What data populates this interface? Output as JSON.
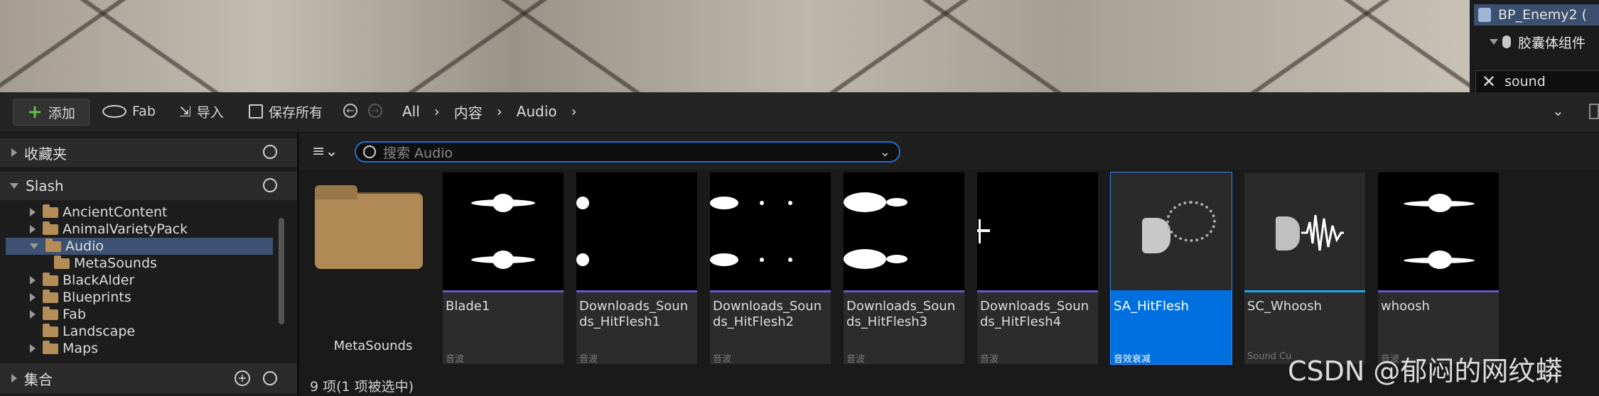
{
  "outliner": {
    "row1": "BP_Enemy2 (",
    "row2": "胶囊体组件",
    "search_value": "sound"
  },
  "toolbar": {
    "add_label": "添加",
    "fab_label": "Fab",
    "import_label": "导入",
    "save_all_label": "保存所有",
    "breadcrumb": [
      "All",
      "内容",
      "Audio"
    ]
  },
  "left_panel": {
    "favorites_label": "收藏夹",
    "project_label": "Slash",
    "folders": [
      "AncientContent",
      "AnimalVarietyPack",
      "Audio",
      "MetaSounds",
      "BlackAlder",
      "Blueprints",
      "Fab",
      "Landscape",
      "Maps"
    ],
    "collections_label": "集合"
  },
  "content": {
    "search_placeholder": "搜索 Audio",
    "assets": [
      {
        "name": "MetaSounds",
        "type": ""
      },
      {
        "name": "Blade1",
        "type": "音波"
      },
      {
        "name": "Downloads_Sounds_HitFlesh1",
        "type": "音波"
      },
      {
        "name": "Downloads_Sounds_HitFlesh2",
        "type": "音波"
      },
      {
        "name": "Downloads_Sounds_HitFlesh3",
        "type": "音波"
      },
      {
        "name": "Downloads_Sounds_HitFlesh4",
        "type": "音波"
      },
      {
        "name": "SA_HitFlesh",
        "type": "音效衰减"
      },
      {
        "name": "SC_Whoosh",
        "type": "Sound Cu"
      },
      {
        "name": "whoosh",
        "type": "音波"
      }
    ],
    "status": "9 项(1 项被选中)"
  },
  "watermark": "CSDN @郁闷的网纹蟒",
  "colors": {
    "accent": "#0070e0",
    "soundwave_bar": "#6c56c9",
    "cue_bar": "#23a6e6",
    "folder": "#b58d57"
  }
}
